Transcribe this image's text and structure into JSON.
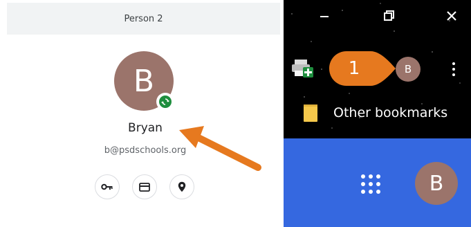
{
  "profile_menu": {
    "header_title": "Person 2",
    "avatar_initial": "B",
    "name": "Bryan",
    "email": "b@psdschools.org",
    "actions": [
      "key-icon",
      "card-icon",
      "location-icon"
    ]
  },
  "browser_toolbar": {
    "callout_number": "1",
    "avatar_initial": "B",
    "window_buttons": [
      "minimize-icon",
      "restore-icon",
      "close-icon"
    ],
    "bookmarks": {
      "other_bookmarks_label": "Other bookmarks"
    }
  },
  "google_bar": {
    "avatar_initial": "B"
  },
  "colors": {
    "avatar_bg": "#9b746b",
    "sync_badge": "#1e8e3e",
    "annotation_orange": "#e6791f",
    "blue_bar": "#3568e0"
  }
}
